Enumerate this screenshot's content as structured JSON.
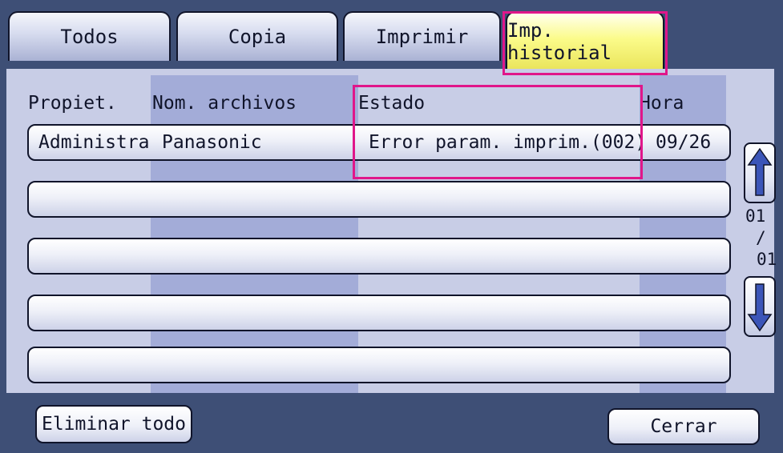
{
  "tabs": [
    {
      "label": "Todos",
      "active": false
    },
    {
      "label": "Copia",
      "active": false
    },
    {
      "label": "Imprimir",
      "active": false
    },
    {
      "label": "Imp. historial",
      "active": true
    }
  ],
  "columns": {
    "owner": "Propiet.",
    "file_name": "Nom. archivos",
    "status": "Estado",
    "time": "Hora"
  },
  "rows": [
    {
      "owner": "Administra",
      "file_name": "Panasonic",
      "status": "Error param. imprim.(002)",
      "time": "09/26"
    },
    {
      "owner": "",
      "file_name": "",
      "status": "",
      "time": ""
    },
    {
      "owner": "",
      "file_name": "",
      "status": "",
      "time": ""
    },
    {
      "owner": "",
      "file_name": "",
      "status": "",
      "time": ""
    },
    {
      "owner": "",
      "file_name": "",
      "status": "",
      "time": ""
    }
  ],
  "pager": {
    "current": "01",
    "separator": "/",
    "total": "01"
  },
  "scroll": {
    "up_icon": "arrow-up-icon",
    "down_icon": "arrow-down-icon"
  },
  "buttons": {
    "delete_all": "Eliminar todo",
    "close": "Cerrar"
  },
  "colors": {
    "highlight": "#e0168a",
    "active_tab": "#fbfb8a",
    "background": "#3e4f76",
    "column_stripe": "#a3acd8"
  }
}
